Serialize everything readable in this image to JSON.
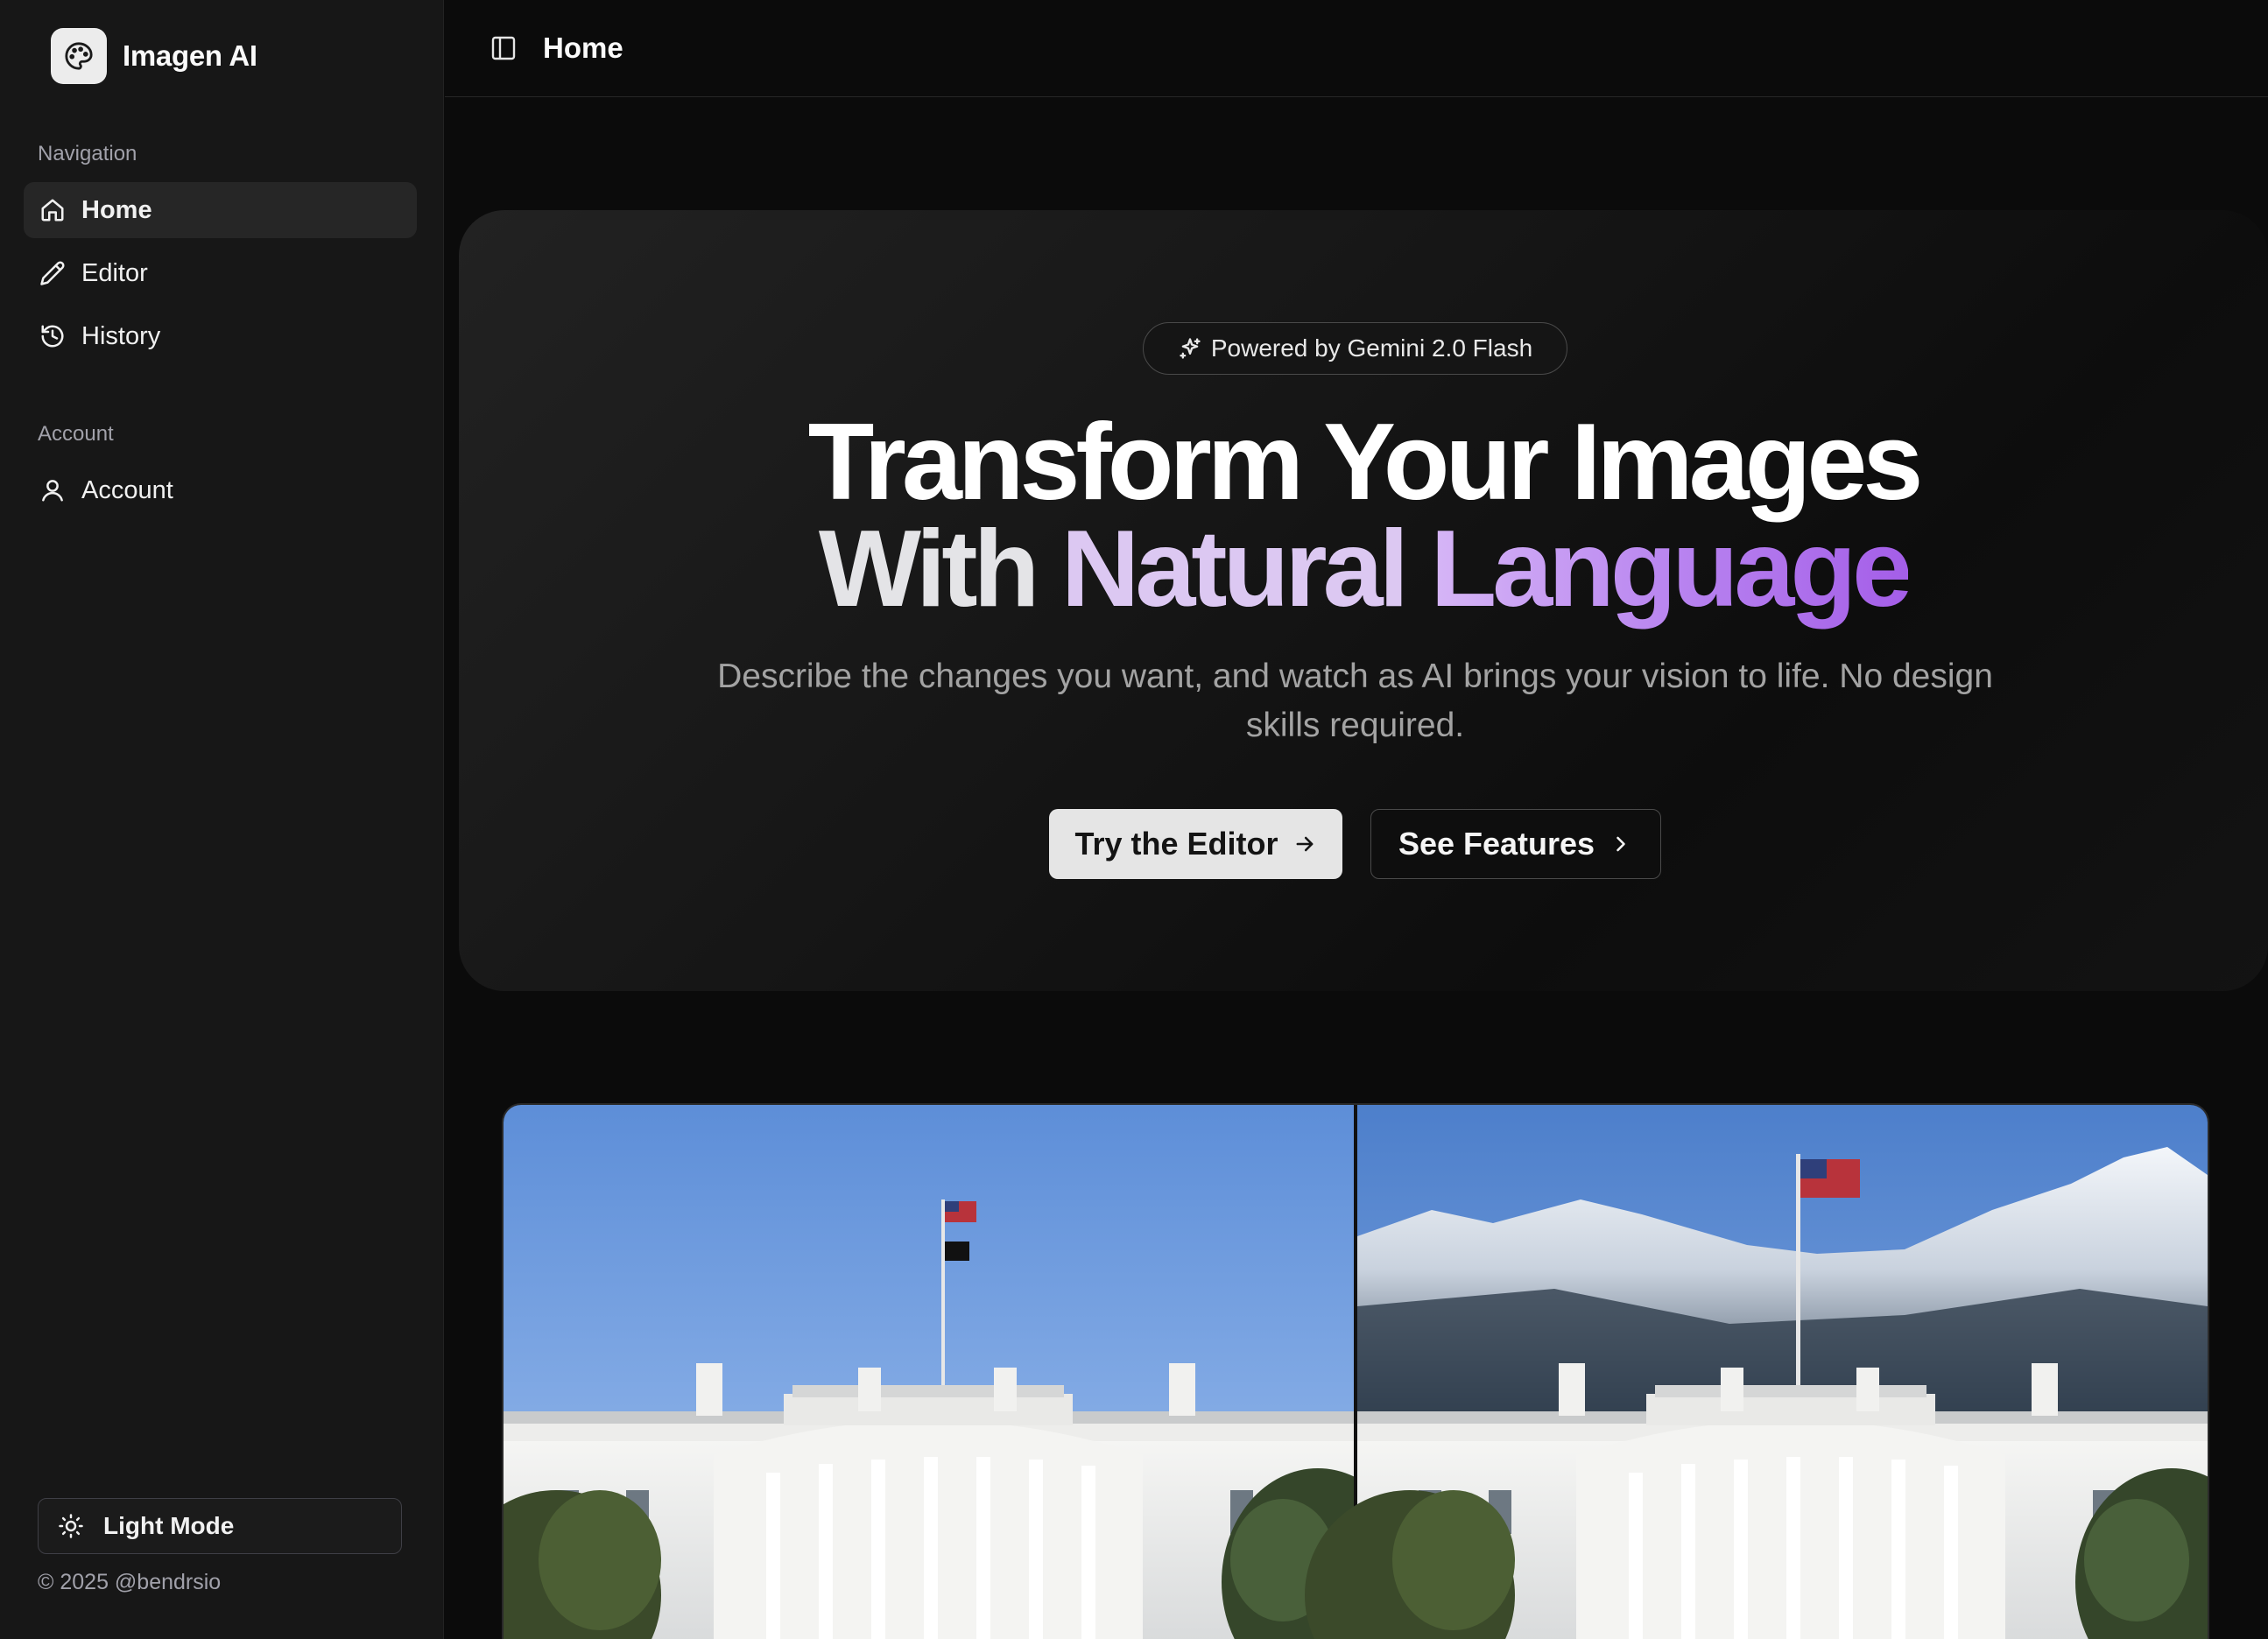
{
  "app": {
    "name": "Imagen AI",
    "logo_icon": "palette-icon"
  },
  "sidebar": {
    "navigation_label": "Navigation",
    "nav_items": [
      {
        "label": "Home",
        "icon": "home-icon",
        "active": true
      },
      {
        "label": "Editor",
        "icon": "pencil-icon",
        "active": false
      },
      {
        "label": "History",
        "icon": "history-icon",
        "active": false
      }
    ],
    "account_label": "Account",
    "account_items": [
      {
        "label": "Account",
        "icon": "user-icon"
      }
    ],
    "theme_toggle": {
      "label": "Light Mode",
      "icon": "sun-icon"
    },
    "copyright": "© 2025 @bendrsio"
  },
  "topbar": {
    "title": "Home",
    "toggle_icon": "sidebar-toggle-icon"
  },
  "hero": {
    "badge": "Powered by Gemini 2.0 Flash",
    "headline_line1": "Transform Your Images",
    "headline_line2_word1": "With",
    "headline_line2_word2": "Natural",
    "headline_line2_word3": "Language",
    "subtitle": "Describe the changes you want, and watch as AI brings your vision to life. No design skills required.",
    "primary_button": "Try the Editor",
    "secondary_button": "See Features"
  },
  "comparison": {
    "before": "White House with clear blue sky",
    "after": "White House with snowy mountains behind"
  },
  "colors": {
    "background": "#0b0b0b",
    "sidebar": "#171717",
    "accent_purple": "#a45ee8",
    "accent_lavender": "#dcc8f2"
  }
}
